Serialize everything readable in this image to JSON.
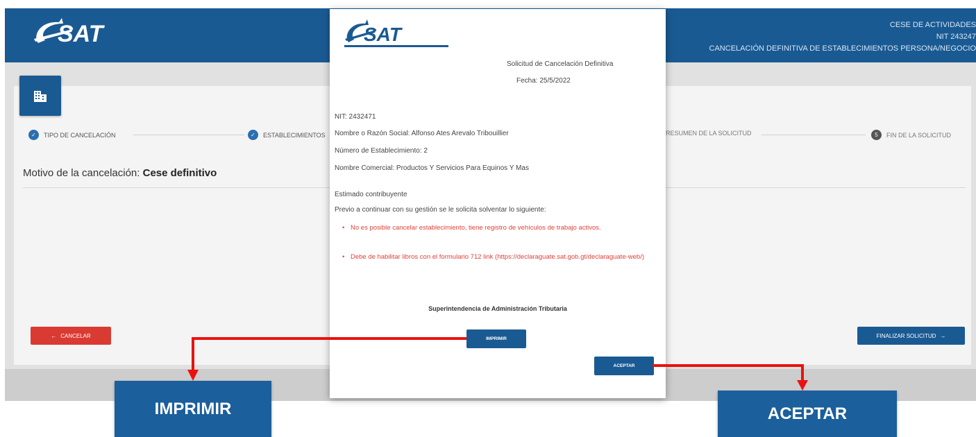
{
  "header": {
    "line1": "CESE DE ACTIVIDADES",
    "line2": "NIT 243247",
    "line3": "CANCELACIÓN DEFINITIVA DE ESTABLECIMIENTOS PERSONA/NEGOCIO"
  },
  "logo": {
    "text": "SAT",
    "subtitle": "Superintendencia de Administración Tributaria"
  },
  "steps": [
    {
      "label": "TIPO DE CANCELACIÓN",
      "status": "done"
    },
    {
      "label": "ESTABLECIMIENTOS",
      "status": "done"
    },
    {
      "label": "RESUMEN DE LA SOLICITUD",
      "status": "pending"
    },
    {
      "label": "FIN DE LA SOLICITUD",
      "status": "current",
      "number": "5"
    }
  ],
  "main": {
    "motivo_label": "Motivo de la cancelación:",
    "motivo_value": "Cese definitivo",
    "cancel_label": "CANCELAR",
    "finalize_label": "FINALIZAR SOLICITUD"
  },
  "modal": {
    "title": "Solicitud de Cancelación Definitiva",
    "fecha": "Fecha: 25/5/2022",
    "nit": "NIT: 2432471",
    "nombre": "Nombre o Razón Social: Alfonso Ates Arevalo Tribouillier",
    "numero": "Número de Establecimiento: 2",
    "comercial": "Nombre Comercial: Productos Y Servicios Para Equinos Y Mas",
    "greeting": "Estimado contribuyente",
    "intro": "Previo a continuar con su gestión se le solicita solventar lo siguiente:",
    "items": [
      "No es posible cancelar establecimiento, tiene registro de vehículos de trabajo activos.",
      "Debe de habilitar libros con el formulario 712 link (https://declaraguate.sat.gob.gt/declaraguate-web/)"
    ],
    "footer": "Superintendencia de Administración Tributaria",
    "print_label": "IMPRIMIR",
    "accept_label": "ACEPTAR"
  },
  "callouts": {
    "imprimir": "IMPRIMIR",
    "aceptar": "ACEPTAR"
  },
  "colors": {
    "brand_blue": "#1a5a93",
    "danger_red": "#d93a32",
    "arrow_red": "#e8130f",
    "warning_text": "#e0403a"
  }
}
